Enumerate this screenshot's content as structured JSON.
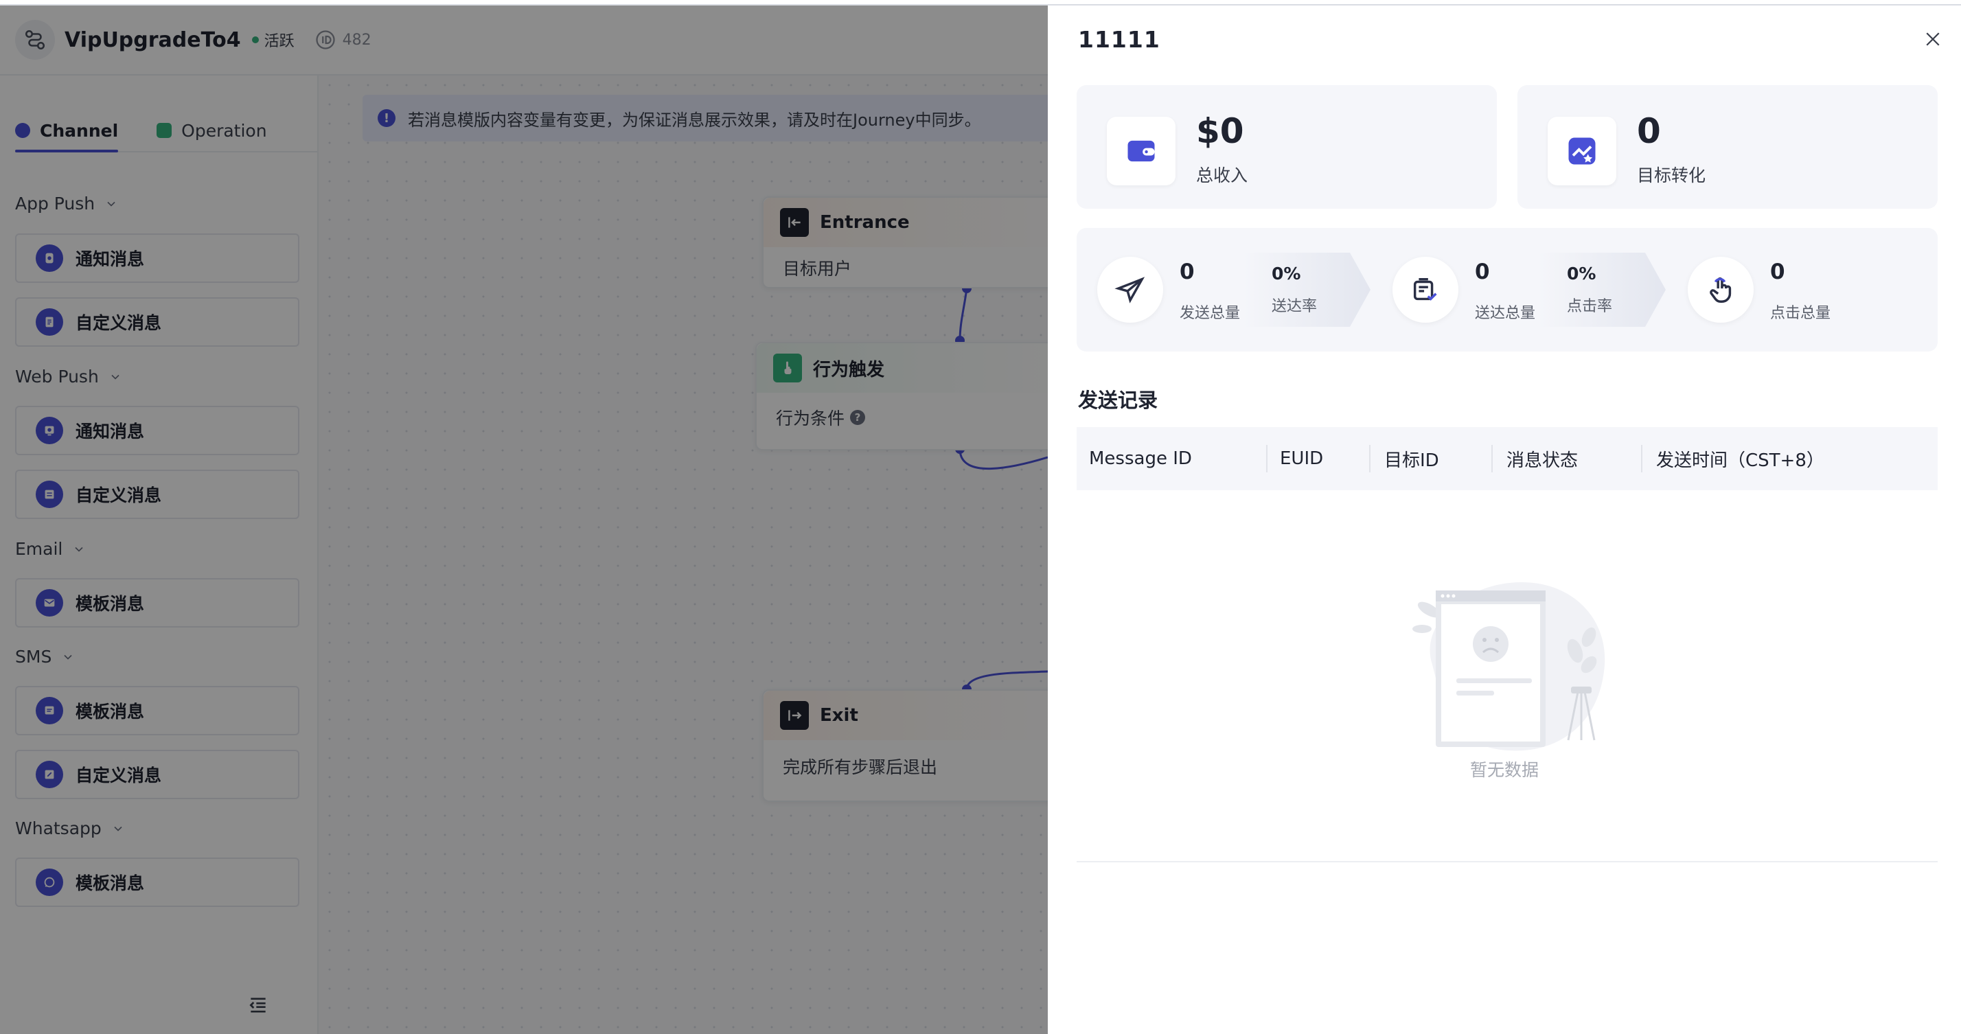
{
  "app": {
    "title": "VipUpgradeTo4",
    "status": "活跃",
    "id_value": "482",
    "accent": "#4950d6"
  },
  "sidebar": {
    "tabs": [
      {
        "label": "Channel",
        "color": "#4950d6",
        "active": true
      },
      {
        "label": "Operation",
        "color": "#36b37e",
        "active": false
      }
    ],
    "groups": [
      {
        "title": "App Push",
        "items": [
          {
            "label": "通知消息",
            "icon": "bell-icon"
          },
          {
            "label": "自定义消息",
            "icon": "document-icon"
          }
        ]
      },
      {
        "title": "Web Push",
        "items": [
          {
            "label": "通知消息",
            "icon": "bell-icon"
          },
          {
            "label": "自定义消息",
            "icon": "document-icon"
          }
        ]
      },
      {
        "title": "Email",
        "items": [
          {
            "label": "模板消息",
            "icon": "mail-icon"
          }
        ]
      },
      {
        "title": "SMS",
        "items": [
          {
            "label": "模板消息",
            "icon": "chat-icon"
          },
          {
            "label": "自定义消息",
            "icon": "edit-icon"
          }
        ]
      },
      {
        "title": "Whatsapp",
        "items": [
          {
            "label": "模板消息",
            "icon": "whatsapp-icon"
          }
        ]
      }
    ]
  },
  "canvas": {
    "banner": "若消息模版内容变量有变更，为保证消息展示效果，请及时在Journey中同步。",
    "nodes": {
      "entrance": {
        "title": "Entrance",
        "body": "目标用户"
      },
      "trigger": {
        "title": "行为触发",
        "body": "行为条件"
      },
      "exit": {
        "title": "Exit",
        "body": "完成所有步骤后退出"
      }
    }
  },
  "drawer": {
    "title": "11111",
    "kpis": [
      {
        "value": "$0",
        "label": "总收入",
        "icon": "wallet-icon"
      },
      {
        "value": "0",
        "label": "目标转化",
        "icon": "chart-star-icon"
      }
    ],
    "funnel": {
      "sent": {
        "value": "0",
        "label": "发送总量"
      },
      "delivery_rate": {
        "value": "0%",
        "label": "送达率"
      },
      "delivered": {
        "value": "0",
        "label": "送达总量"
      },
      "click_rate": {
        "value": "0%",
        "label": "点击率"
      },
      "clicks": {
        "value": "0",
        "label": "点击总量"
      }
    },
    "records": {
      "title": "发送记录",
      "columns": [
        "Message ID",
        "EUID",
        "目标ID",
        "消息状态",
        "发送时间（CST+8）"
      ],
      "rows": [],
      "empty_text": "暂无数据"
    }
  }
}
